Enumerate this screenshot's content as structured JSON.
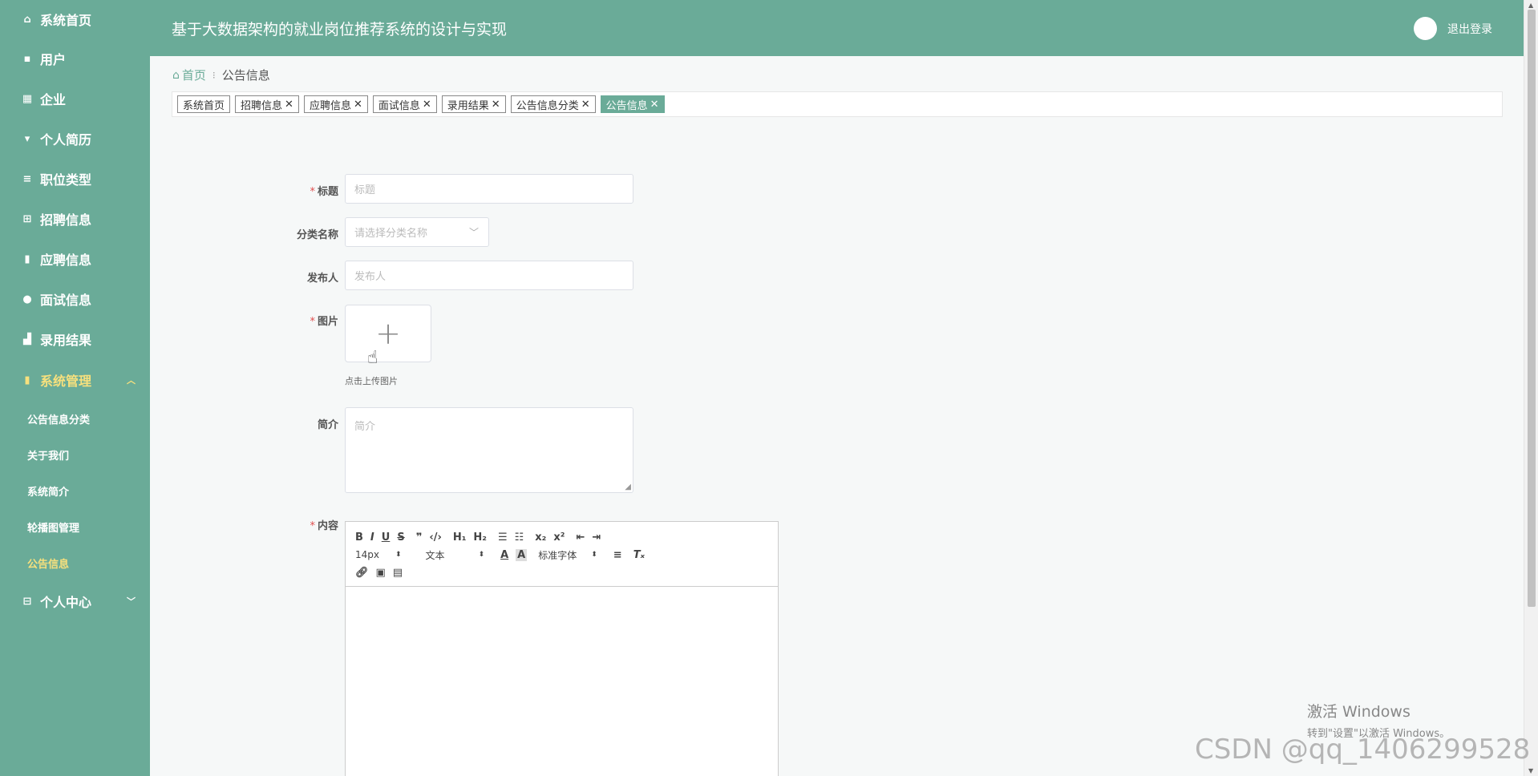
{
  "header": {
    "title": "基于大数据架构的就业岗位推荐系统的设计与实现",
    "logout": "退出登录",
    "avatar_icon": "avatar-icon"
  },
  "sidebar": {
    "items": [
      {
        "label": "系统首页",
        "icon": "home-icon"
      },
      {
        "label": "用户",
        "icon": "chat-icon"
      },
      {
        "label": "企业",
        "icon": "grid-icon"
      },
      {
        "label": "个人简历",
        "icon": "pin-icon"
      },
      {
        "label": "职位类型",
        "icon": "list-icon"
      },
      {
        "label": "招聘信息",
        "icon": "apps-icon"
      },
      {
        "label": "应聘信息",
        "icon": "clipboard-icon"
      },
      {
        "label": "面试信息",
        "icon": "location-icon"
      },
      {
        "label": "录用结果",
        "icon": "thumb-icon"
      }
    ],
    "system": {
      "label": "系统管理",
      "icon": "clipboard-icon",
      "sub": [
        {
          "label": "公告信息分类"
        },
        {
          "label": "关于我们"
        },
        {
          "label": "系统简介"
        },
        {
          "label": "轮播图管理"
        },
        {
          "label": "公告信息"
        }
      ]
    },
    "personal": {
      "label": "个人中心",
      "icon": "card-icon"
    }
  },
  "breadcrumb": {
    "home": "首页",
    "current": "公告信息"
  },
  "tags": [
    {
      "label": "系统首页",
      "closable": false
    },
    {
      "label": "招聘信息",
      "closable": true
    },
    {
      "label": "应聘信息",
      "closable": true
    },
    {
      "label": "面试信息",
      "closable": true
    },
    {
      "label": "录用结果",
      "closable": true
    },
    {
      "label": "公告信息分类",
      "closable": true
    },
    {
      "label": "公告信息",
      "closable": true,
      "active": true
    }
  ],
  "form": {
    "title_label": "标题",
    "title_placeholder": "标题",
    "category_label": "分类名称",
    "category_placeholder": "请选择分类名称",
    "publisher_label": "发布人",
    "publisher_placeholder": "发布人",
    "image_label": "图片",
    "image_tip": "点击上传图片",
    "intro_label": "简介",
    "intro_placeholder": "简介",
    "content_label": "内容"
  },
  "editor": {
    "font_size": "14px",
    "block_type": "文本",
    "font_family": "标准字体"
  },
  "watermark": {
    "activate_title": "激活 Windows",
    "activate_sub": "转到\"设置\"以激活 Windows。",
    "csdn": "CSDN @qq_1406299528"
  },
  "colors": {
    "theme": "#6aab98",
    "accent_yellow": "#f7e07d",
    "required": "#e04e4e"
  }
}
